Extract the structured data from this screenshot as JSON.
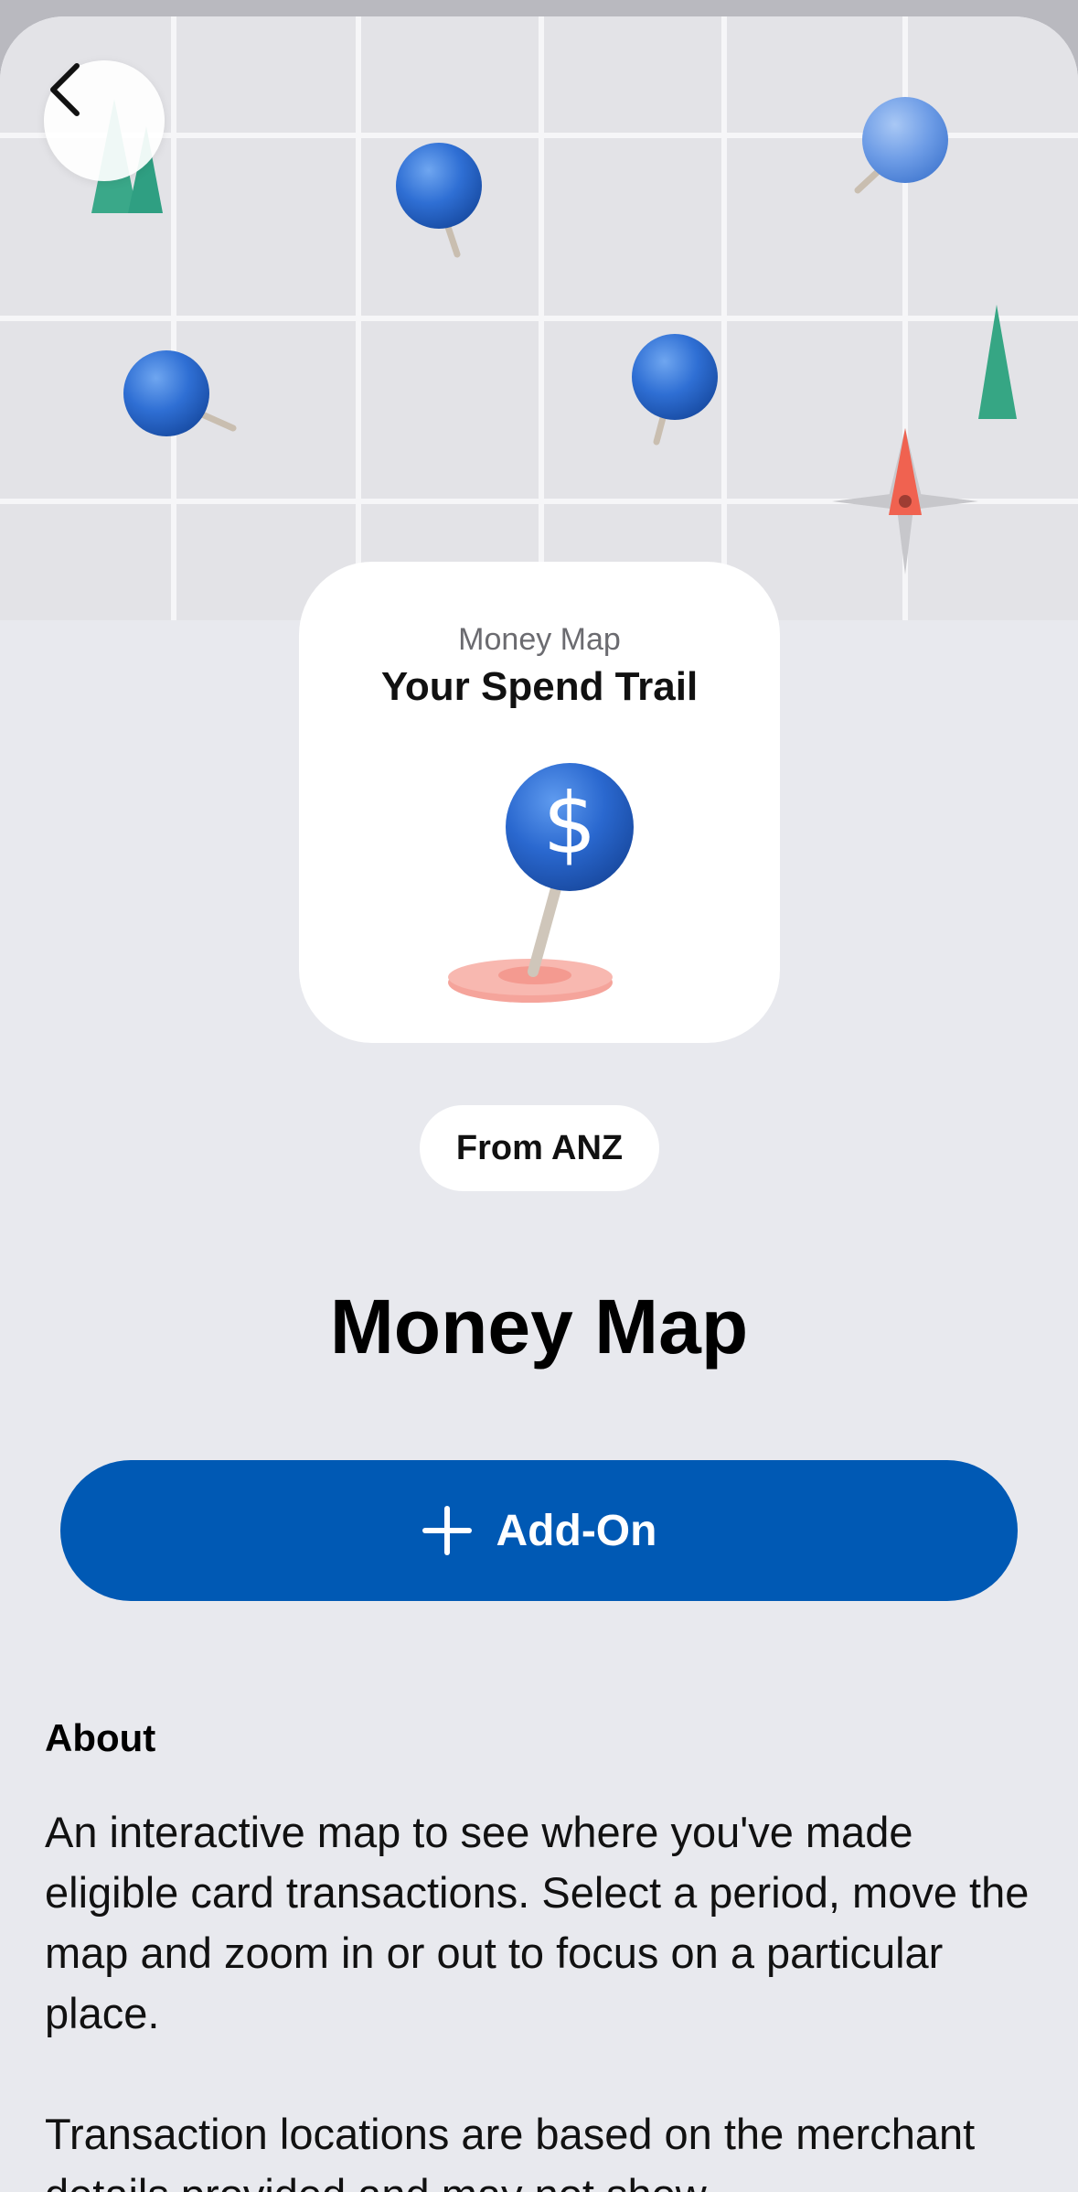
{
  "header": {
    "back_icon": "chevron-left-icon"
  },
  "hero": {
    "illustration": "map-with-pins"
  },
  "card": {
    "subtitle": "Money Map",
    "title": "Your Spend Trail",
    "icon": "dollar-pin-icon"
  },
  "provider": {
    "label": "From ANZ"
  },
  "page": {
    "title": "Money Map"
  },
  "add_button": {
    "icon": "plus-icon",
    "label": "Add-On",
    "color": "#0059b4"
  },
  "about": {
    "heading": "About",
    "paragraph1": "An interactive map to see where you've made eligible card transactions. Select a period, move the map and zoom in or out to focus on a particular place.",
    "paragraph2": "Transaction locations are based on the merchant details provided and may not show"
  },
  "colors": {
    "background": "#e8e9ee",
    "accent": "#0059b4",
    "pin_blue": "#2f73d6",
    "compass_red": "#f06250"
  }
}
